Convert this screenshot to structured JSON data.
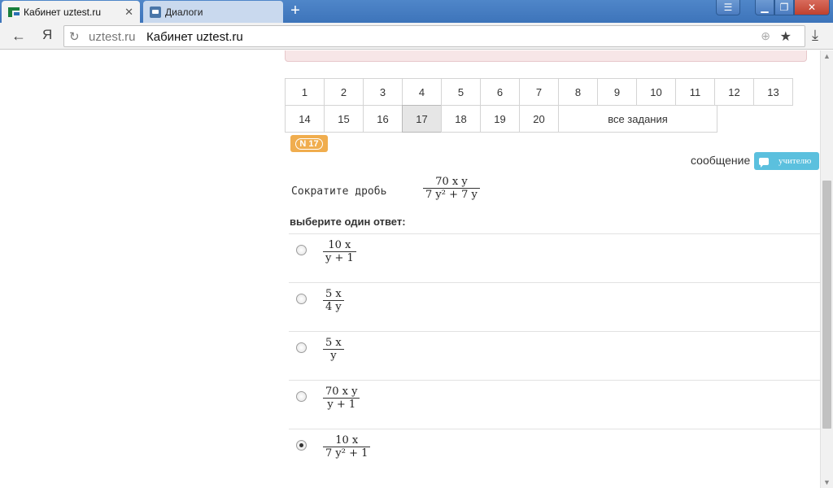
{
  "browser": {
    "tabs": [
      {
        "title": "Кабинет uztest.ru",
        "active": true
      },
      {
        "title": "Диалоги",
        "active": false
      }
    ],
    "new_tab": "+",
    "ya_label": "Я",
    "url_domain": "uztest.ru",
    "url_title": "Кабинет uztest.ru"
  },
  "nav": {
    "row1": [
      "1",
      "2",
      "3",
      "4",
      "5",
      "6",
      "7",
      "8",
      "9",
      "10",
      "11",
      "12",
      "13"
    ],
    "row2": [
      "14",
      "15",
      "16",
      "17",
      "18",
      "19",
      "20"
    ],
    "all_tasks": "все задания",
    "current": "17"
  },
  "task": {
    "badge": "N 17",
    "message_label": "сообщение",
    "message_button": "учителю",
    "prompt": "Сократите дробь",
    "fraction": {
      "num": "70 x y",
      "den": "7 y² + 7 y"
    },
    "choose_label": "выберите один ответ:",
    "answers": [
      {
        "num": "10 x",
        "den": "y + 1",
        "selected": false
      },
      {
        "num": "5 x",
        "den": "4 y",
        "selected": false
      },
      {
        "num": "5 x",
        "den": "y",
        "selected": false
      },
      {
        "num": "70 x y",
        "den": "y + 1",
        "selected": false
      },
      {
        "num": "10 x",
        "den": "7 y² + 1",
        "selected": true
      }
    ]
  },
  "colors": {
    "tabbar": "#3d74ba",
    "badge": "#f0ad4e",
    "message_button": "#5bc0de",
    "alert": "#f7e6e7"
  },
  "icons": [
    "favicon-uztest-icon",
    "dialog-icon",
    "close-icon",
    "plus-icon",
    "menu-icon",
    "minimize-icon",
    "maximize-icon",
    "window-close-icon",
    "back-arrow-icon",
    "reload-icon",
    "globe-icon",
    "star-icon",
    "download-icon",
    "chat-bubble-icon"
  ]
}
